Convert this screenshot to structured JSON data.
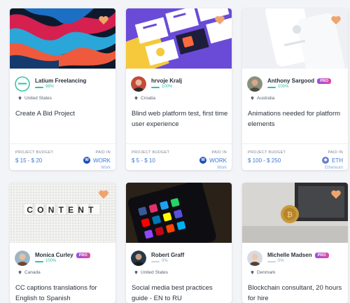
{
  "labels": {
    "budget": "PROJECT BUDGET",
    "paid": "PAID IN"
  },
  "cards": [
    {
      "user": "Latium Freelancing",
      "pro": "",
      "score": "98%",
      "country": "United States",
      "title": "Create A Bid Project",
      "budget": "$ 15 - $ 20",
      "currency": "WORK",
      "currency_sub": "Work"
    },
    {
      "user": "hrvoje Kralj",
      "pro": "",
      "score": "100%",
      "country": "Croatia",
      "title": "Blind web platform test, first time user experience",
      "budget": "$ 5 - $ 10",
      "currency": "WORK",
      "currency_sub": "Work"
    },
    {
      "user": "Anthony Sargood",
      "pro": "PRO",
      "score": "100%",
      "country": "Australia",
      "title": "Animations needed for platform elements",
      "budget": "$ 100 - $ 250",
      "currency": "ETH",
      "currency_sub": "Ethereum"
    },
    {
      "user": "Monica Curley",
      "pro": "PRO",
      "score": "100%",
      "country": "Canada",
      "title": "CC captions translations for English to Spanish",
      "image_text": "CONTENT"
    },
    {
      "user": "Robert Graff",
      "pro": "",
      "score": "0%",
      "country": "United States",
      "title": "Social media best practices guide - EN to RU"
    },
    {
      "user": "Michelle Madsen",
      "pro": "PRO",
      "score": "0%",
      "country": "Denmark",
      "title": "Blockchain consultant, 20 hours for hire"
    }
  ],
  "colors": {
    "accent": "#3a78d6",
    "score": "#2ec4a3",
    "heart": "#f0a36b"
  },
  "icons": [
    "heart-icon",
    "location-pin-icon",
    "work-coin-icon",
    "eth-coin-icon"
  ]
}
